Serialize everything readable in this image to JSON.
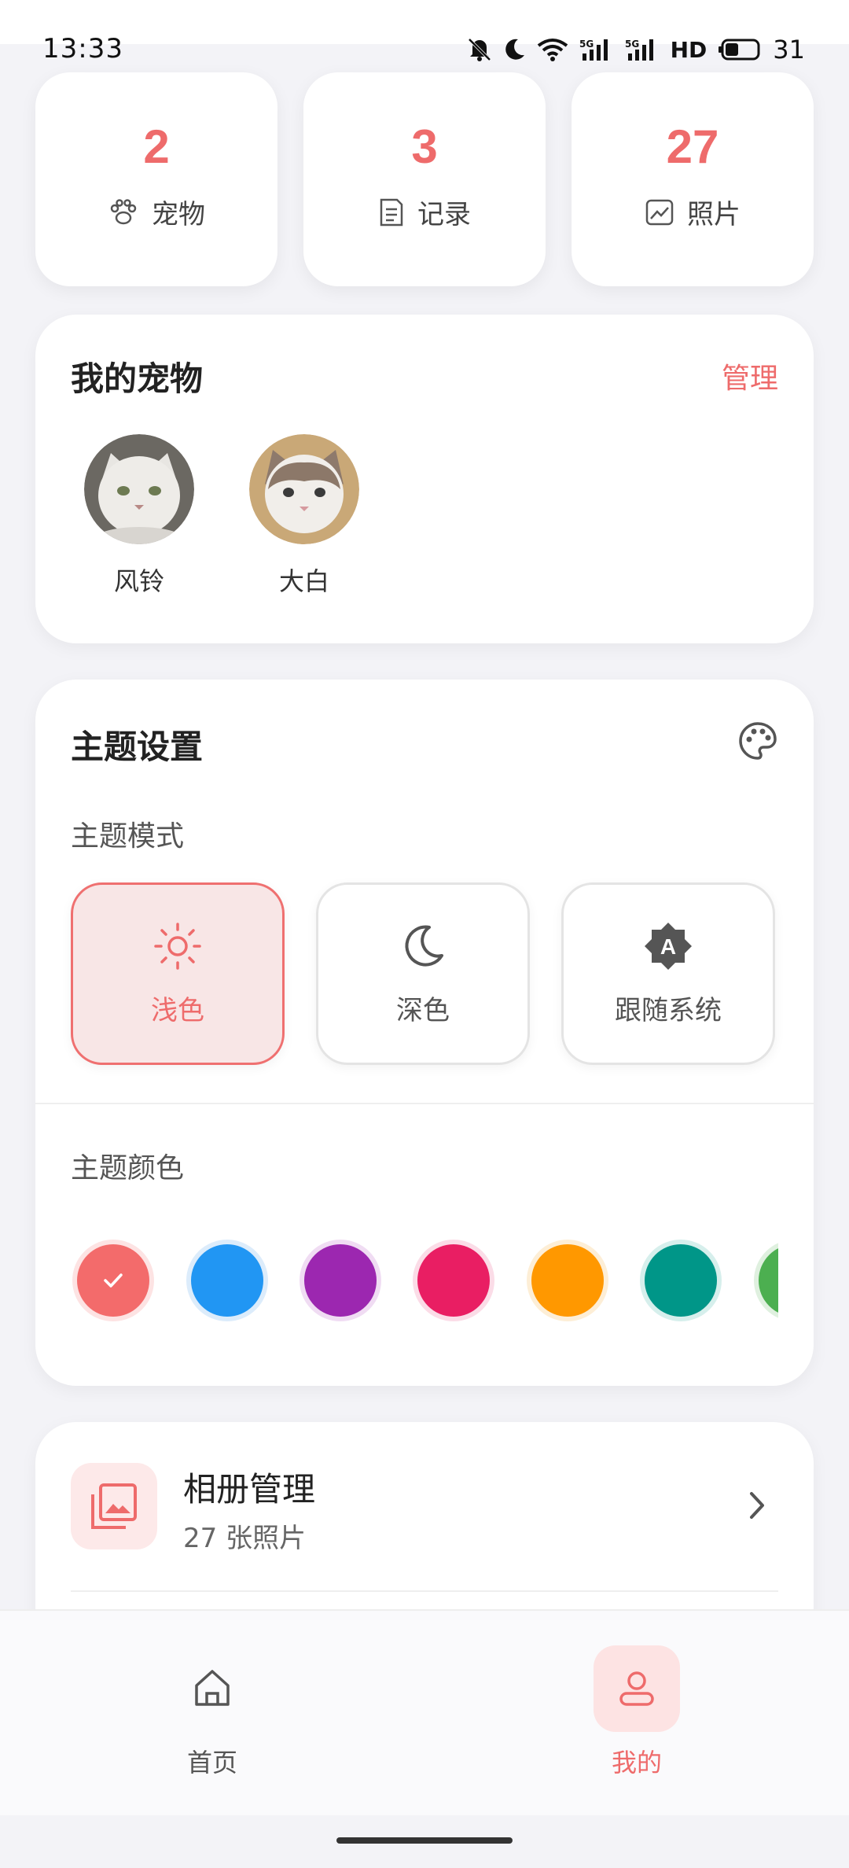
{
  "status": {
    "time": "13:33",
    "battery": "31",
    "network": "HD"
  },
  "stats": [
    {
      "value": "2",
      "label": "宠物",
      "icon": "paw-icon"
    },
    {
      "value": "3",
      "label": "记录",
      "icon": "notes-icon"
    },
    {
      "value": "27",
      "label": "照片",
      "icon": "photo-icon"
    }
  ],
  "pets": {
    "title": "我的宠物",
    "manage": "管理",
    "items": [
      {
        "name": "风铃"
      },
      {
        "name": "大白"
      }
    ]
  },
  "theme": {
    "title": "主题设置",
    "mode_title": "主题模式",
    "modes": [
      {
        "label": "浅色",
        "icon": "sun-icon",
        "selected": true
      },
      {
        "label": "深色",
        "icon": "moon-icon",
        "selected": false
      },
      {
        "label": "跟随系统",
        "icon": "auto-brightness-icon",
        "selected": false
      }
    ],
    "color_title": "主题颜色",
    "colors": [
      "#f36b6b",
      "#2196f3",
      "#9c27b0",
      "#e91e63",
      "#ff9800",
      "#009688",
      "#4caf50"
    ],
    "selected_color": "#f36b6b"
  },
  "album": {
    "title": "相册管理",
    "subtitle": "27 张照片"
  },
  "nav": {
    "home": "首页",
    "mine": "我的",
    "active": "mine"
  }
}
